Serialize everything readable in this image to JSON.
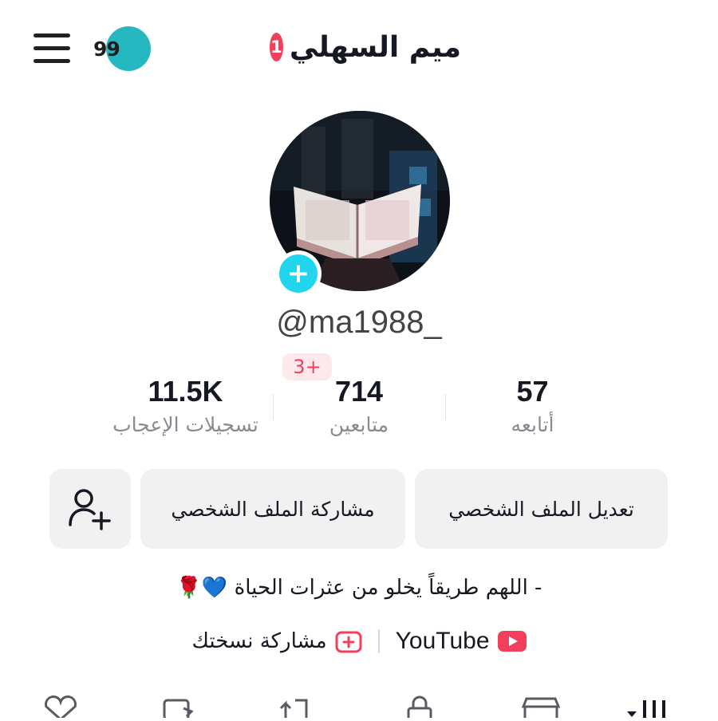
{
  "header": {
    "title": "ميم السهلي",
    "notification_count": "1",
    "streak_value": "99"
  },
  "profile": {
    "username": "@ma1988_",
    "badge": "3+"
  },
  "stats": [
    {
      "value": "57",
      "label": "أتابعه"
    },
    {
      "value": "714",
      "label": "متابعين"
    },
    {
      "value": "11.5K",
      "label": "تسجيلات الإعجاب"
    }
  ],
  "buttons": {
    "edit_profile": "تعديل الملف الشخصي",
    "share_profile": "مشاركة الملف الشخصي"
  },
  "bio": "- اللهم طريقاً يخلو من عثرات الحياة 💙🌹",
  "links": {
    "youtube": "YouTube",
    "share_copy": "مشاركة نسختك"
  },
  "icons": {
    "menu": "hamburger-menu-icon",
    "add_friend": "add-friend-icon",
    "youtube": "youtube-icon",
    "share_copy": "plus-square-icon",
    "tabs": [
      "videos-grid-icon",
      "shop-icon",
      "lock-icon",
      "repost-icon",
      "bookmark-icon",
      "liked-icon"
    ]
  },
  "colors": {
    "accent": "#f23f5c",
    "avatar_add": "#20d5ec",
    "streak": "#25b8c0"
  }
}
